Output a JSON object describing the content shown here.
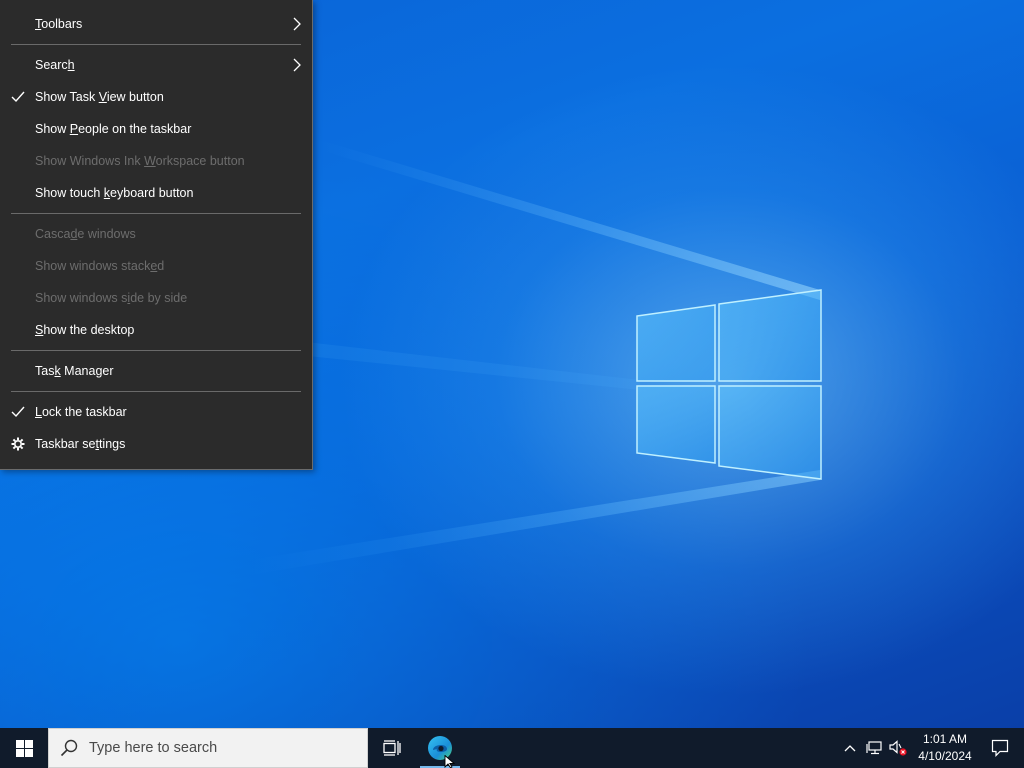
{
  "context_menu": {
    "items": [
      {
        "label_pre": "",
        "mnemonic": "T",
        "label_post": "oolbars",
        "checked": false,
        "disabled": false,
        "submenu": true
      },
      {
        "label_pre": "Searc",
        "mnemonic": "h",
        "label_post": "",
        "checked": false,
        "disabled": false,
        "submenu": true
      },
      {
        "label_pre": "Show Task ",
        "mnemonic": "V",
        "label_post": "iew button",
        "checked": true,
        "disabled": false,
        "submenu": false
      },
      {
        "label_pre": "Show ",
        "mnemonic": "P",
        "label_post": "eople on the taskbar",
        "checked": false,
        "disabled": false,
        "submenu": false
      },
      {
        "label_pre": "Show Windows Ink ",
        "mnemonic": "W",
        "label_post": "orkspace button",
        "checked": false,
        "disabled": true,
        "submenu": false
      },
      {
        "label_pre": "Show touch ",
        "mnemonic": "k",
        "label_post": "eyboard button",
        "checked": false,
        "disabled": false,
        "submenu": false
      },
      {
        "label_pre": "Casca",
        "mnemonic": "d",
        "label_post": "e windows",
        "checked": false,
        "disabled": true,
        "submenu": false
      },
      {
        "label_pre": "Show windows stack",
        "mnemonic": "e",
        "label_post": "d",
        "checked": false,
        "disabled": true,
        "submenu": false
      },
      {
        "label_pre": "Show windows s",
        "mnemonic": "i",
        "label_post": "de by side",
        "checked": false,
        "disabled": true,
        "submenu": false
      },
      {
        "label_pre": "",
        "mnemonic": "S",
        "label_post": "how the desktop",
        "checked": false,
        "disabled": false,
        "submenu": false
      },
      {
        "label_pre": "Tas",
        "mnemonic": "k",
        "label_post": " Manager",
        "checked": false,
        "disabled": false,
        "submenu": false
      },
      {
        "label_pre": "",
        "mnemonic": "L",
        "label_post": "ock the taskbar",
        "checked": true,
        "disabled": false,
        "submenu": false
      },
      {
        "label_pre": "Taskbar se",
        "mnemonic": "t",
        "label_post": "tings",
        "checked": false,
        "disabled": false,
        "submenu": false
      }
    ]
  },
  "taskbar": {
    "search_placeholder": "Type here to search",
    "clock_time": "1:01 AM",
    "clock_date": "4/10/2024"
  },
  "icons": {
    "start": "windows-logo-icon",
    "search": "search-icon",
    "taskview": "task-view-icon",
    "edge": "edge-browser-icon",
    "tray_chevron": "chevron-up-icon",
    "network": "network-icon",
    "volume": "volume-muted-icon",
    "notifications": "notification-center-icon",
    "settings": "gear-icon"
  },
  "colors": {
    "menu_bg": "#2b2b2b",
    "menu_disabled_text": "#6d6d6d",
    "taskbar_bg": "#101b2b",
    "desktop_accent": "#0a63d6"
  }
}
